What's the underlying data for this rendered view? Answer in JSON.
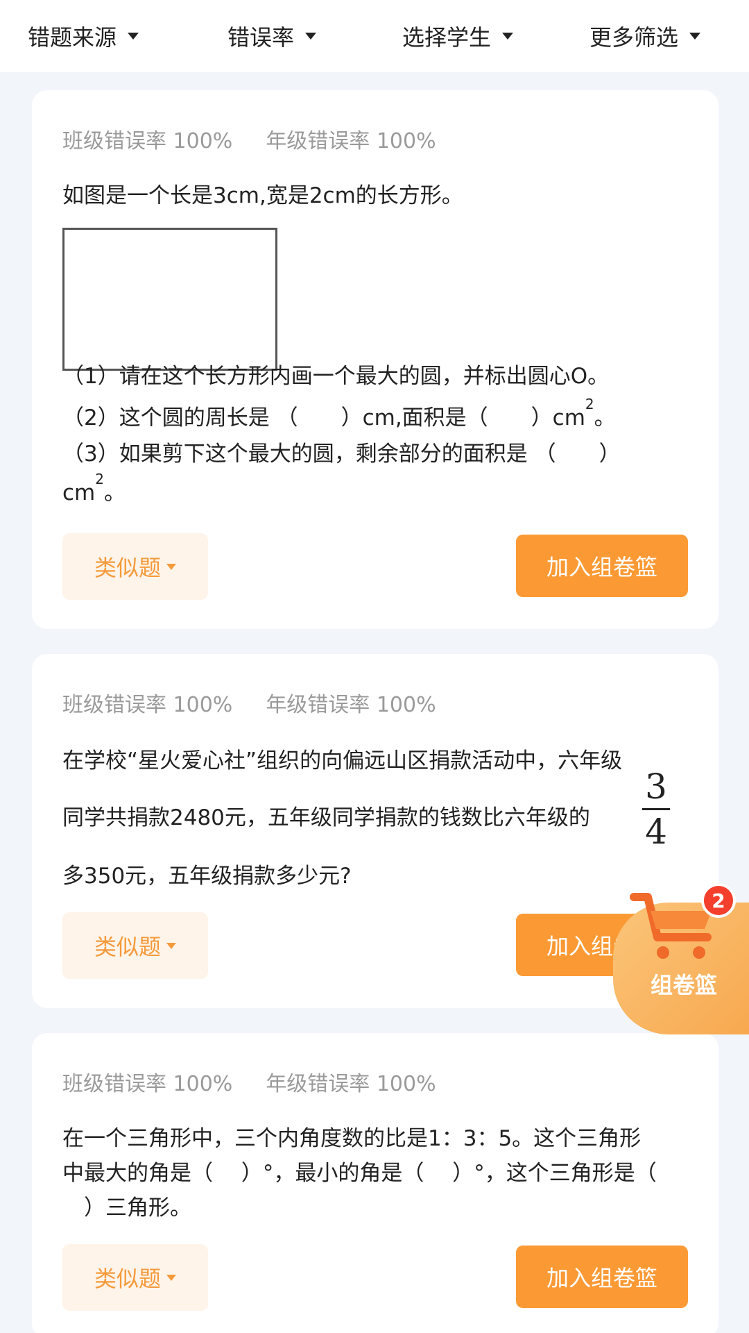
{
  "filters": [
    {
      "label": "错题来源"
    },
    {
      "label": "错误率"
    },
    {
      "label": "选择学生"
    },
    {
      "label": "更多筛选"
    }
  ],
  "cards": [
    {
      "class_rate": "班级错误率 100%",
      "grade_rate": "年级错误率 100%",
      "lines": [
        "如图是一个长是3cm,宽是2cm的长方形。",
        "（1）请在这个长方形内画一个最大的圆，并标出圆心O。",
        "（2）这个圆的周长是 （　　）cm,面积是（　　）cm",
        "（3）如果剪下这个最大的圆，剩余部分的面积是 （　　）",
        "cm"
      ],
      "sup": "2",
      "tail": "。",
      "similar_label": "类似题",
      "add_label": "加入组卷篮"
    },
    {
      "class_rate": "班级错误率 100%",
      "grade_rate": "年级错误率 100%",
      "lines": [
        "在学校“星火爱心社”组织的向偏远山区捐款活动中，六年级",
        "同学共捐款2480元，五年级同学捐款的钱数比六年级的",
        "多350元，五年级捐款多少元?"
      ],
      "frac_num": "3",
      "frac_den": "4",
      "similar_label": "类似题",
      "add_label": "加入组卷篮"
    },
    {
      "class_rate": "班级错误率 100%",
      "grade_rate": "年级错误率 100%",
      "lines": [
        "在一个三角形中，三个内角度数的比是1：3：5。这个三角形",
        "中最大的角是（　 ）°，最小的角是（　 ）°，这个三角形是（",
        "　）三角形。"
      ],
      "similar_label": "类似题",
      "add_label": "加入组卷篮"
    }
  ],
  "basket": {
    "label": "组卷篮",
    "count": "2"
  },
  "colors": {
    "accent": "#fb9a35",
    "accent_light": "#fff4ea",
    "badge": "#f43f2d",
    "bg": "#f2f5fa"
  }
}
